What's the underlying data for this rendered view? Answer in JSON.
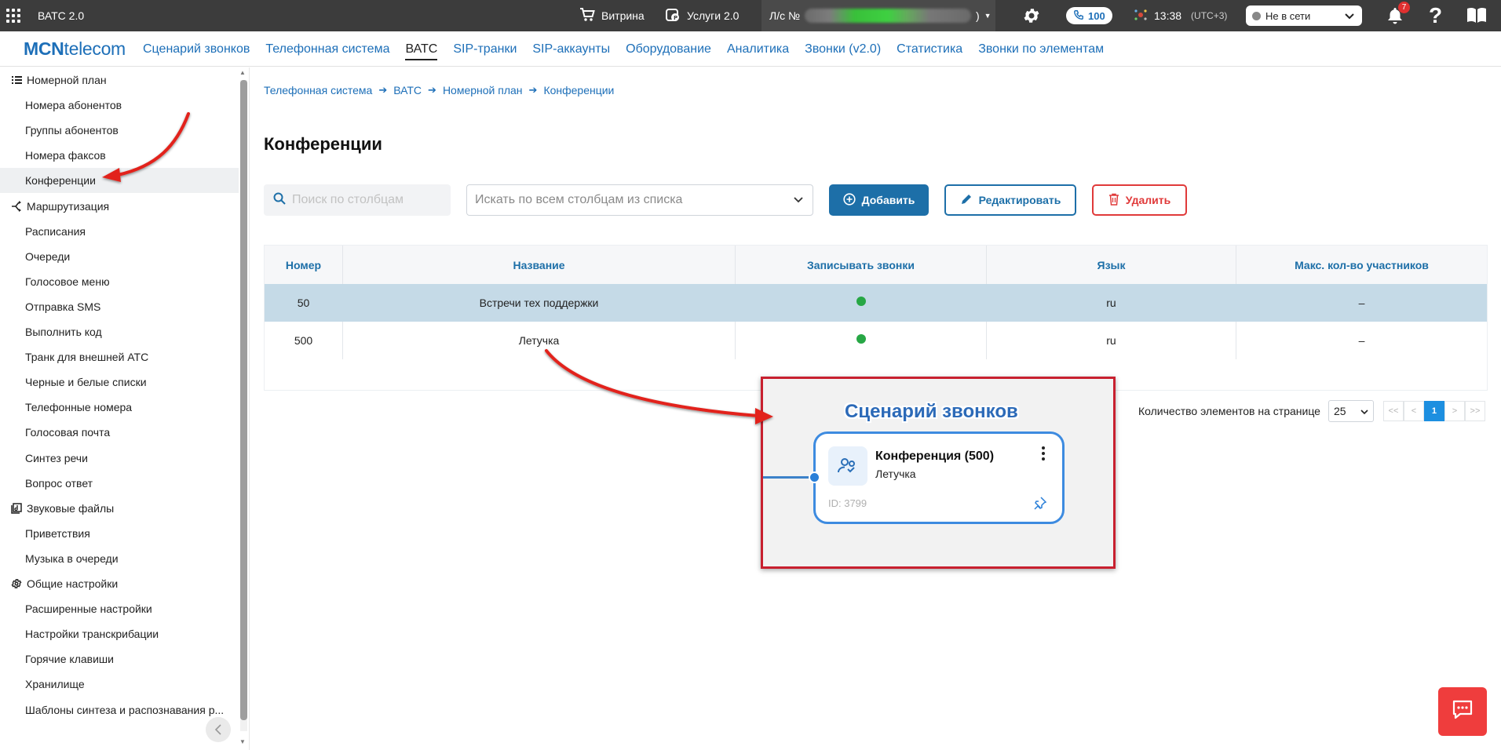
{
  "topbar": {
    "app_title": "ВАТС 2.0",
    "shop_label": "Витрина",
    "services_label": "Услуги 2.0",
    "account_label": "Л/с №",
    "account_suffix": ")",
    "calls_count": "100",
    "time": "13:38",
    "timezone": "(UTC+3)",
    "status_value": "Не в сети",
    "notifications_count": "7",
    "help_label": "?"
  },
  "navbar": {
    "brand_bold": "MCN",
    "brand_rest": "telecom",
    "items": [
      {
        "label": "Сценарий звонков"
      },
      {
        "label": "Телефонная система"
      },
      {
        "label": "ВАТС"
      },
      {
        "label": "SIP-транки"
      },
      {
        "label": "SIP-аккаунты"
      },
      {
        "label": "Оборудование"
      },
      {
        "label": "Аналитика"
      },
      {
        "label": "Звонки (v2.0)"
      },
      {
        "label": "Статистика"
      },
      {
        "label": "Звонки по элементам"
      }
    ],
    "active_index": 2
  },
  "sidebar": {
    "groups": [
      {
        "label": "Номерной план",
        "icon": "list-icon"
      },
      {
        "label": "Маршрутизация",
        "icon": "routing-icon"
      },
      {
        "label": "Звуковые файлы",
        "icon": "audio-file-icon"
      },
      {
        "label": "Общие настройки",
        "icon": "gear-icon"
      }
    ],
    "items": [
      {
        "label": "Номера абонентов"
      },
      {
        "label": "Группы абонентов"
      },
      {
        "label": "Номера факсов"
      },
      {
        "label": "Конференции"
      },
      {
        "label": "Расписания"
      },
      {
        "label": "Очереди"
      },
      {
        "label": "Голосовое меню"
      },
      {
        "label": "Отправка SMS"
      },
      {
        "label": "Выполнить код"
      },
      {
        "label": "Транк для внешней АТС"
      },
      {
        "label": "Черные и белые списки"
      },
      {
        "label": "Телефонные номера"
      },
      {
        "label": "Голосовая почта"
      },
      {
        "label": "Синтез речи"
      },
      {
        "label": "Вопрос ответ"
      },
      {
        "label": "Приветствия"
      },
      {
        "label": "Музыка в очереди"
      },
      {
        "label": "Расширенные настройки"
      },
      {
        "label": "Настройки транскрибации"
      },
      {
        "label": "Горячие клавиши"
      },
      {
        "label": "Хранилище"
      },
      {
        "label": "Шаблоны синтеза и распознавания р..."
      }
    ],
    "active_item": "Конференции"
  },
  "breadcrumb": [
    "Телефонная система",
    "ВАТС",
    "Номерной план",
    "Конференции"
  ],
  "page_title": "Конференции",
  "toolbar": {
    "search_placeholder": "Поиск по столбцам",
    "column_select_placeholder": "Искать по всем столбцам из списка",
    "add_label": "Добавить",
    "edit_label": "Редактировать",
    "delete_label": "Удалить"
  },
  "table": {
    "columns": [
      "Номер",
      "Название",
      "Записывать звонки",
      "Язык",
      "Макс. кол-во участников"
    ],
    "rows": [
      {
        "number": "50",
        "name": "Встречи тех поддержки",
        "record": true,
        "lang": "ru",
        "max": "–",
        "selected": true
      },
      {
        "number": "500",
        "name": "Летучка",
        "record": true,
        "lang": "ru",
        "max": "–",
        "selected": false
      }
    ]
  },
  "pagination": {
    "per_page_label": "Количество элементов на странице",
    "per_page_value": "25",
    "first": "<<",
    "prev": "<",
    "current": "1",
    "next": ">",
    "last": ">>"
  },
  "callout": {
    "title": "Сценарий звонков",
    "node_title": "Конференция (500)",
    "node_subtitle": "Летучка",
    "node_id": "ID: 3799"
  },
  "colors": {
    "accent": "#1d6fb8",
    "primary_button": "#1d6fa8",
    "danger": "#e03a3a",
    "selected_row": "#c5dae7",
    "annotation_red": "#e2231a",
    "online_green": "#27a745"
  }
}
